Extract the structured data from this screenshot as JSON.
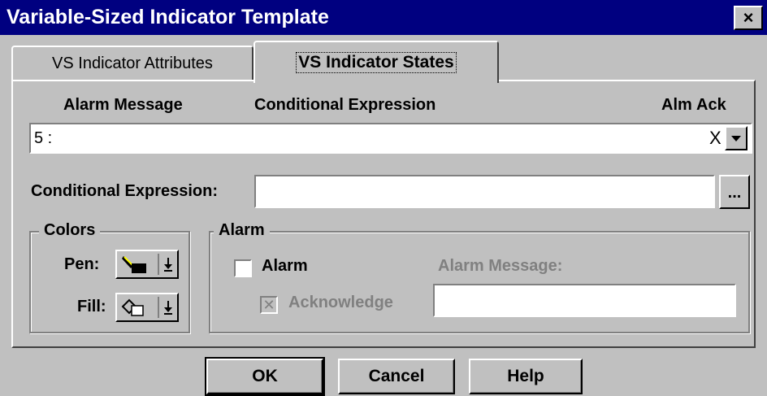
{
  "window": {
    "title": "Variable-Sized Indicator Template",
    "close_label": "×"
  },
  "tabs": [
    {
      "label": "VS Indicator Attributes",
      "active": false
    },
    {
      "label": "VS Indicator States",
      "active": true
    }
  ],
  "states_list": {
    "headers": {
      "alarm_message": "Alarm Message",
      "conditional_expression": "Conditional Expression",
      "alm": "Alm",
      "ack": "Ack"
    },
    "selected_value": "5 :",
    "alarm_flag": "X"
  },
  "conditional_expression": {
    "label": "Conditional Expression:",
    "value": "",
    "browse_label": "..."
  },
  "colors": {
    "group_title": "Colors",
    "pen_label": "Pen:",
    "fill_label": "Fill:",
    "pen_icon": "pen-color-icon",
    "fill_icon": "fill-color-icon",
    "pen_color": "#000000",
    "fill_color": "#ffffff"
  },
  "alarm": {
    "group_title": "Alarm",
    "alarm_checkbox_label": "Alarm",
    "alarm_checked": false,
    "acknowledge_label": "Acknowledge",
    "acknowledge_checked": true,
    "acknowledge_mark": "✕",
    "alarm_message_label": "Alarm Message:",
    "alarm_message_value": ""
  },
  "buttons": {
    "ok": "OK",
    "cancel": "Cancel",
    "help": "Help"
  }
}
